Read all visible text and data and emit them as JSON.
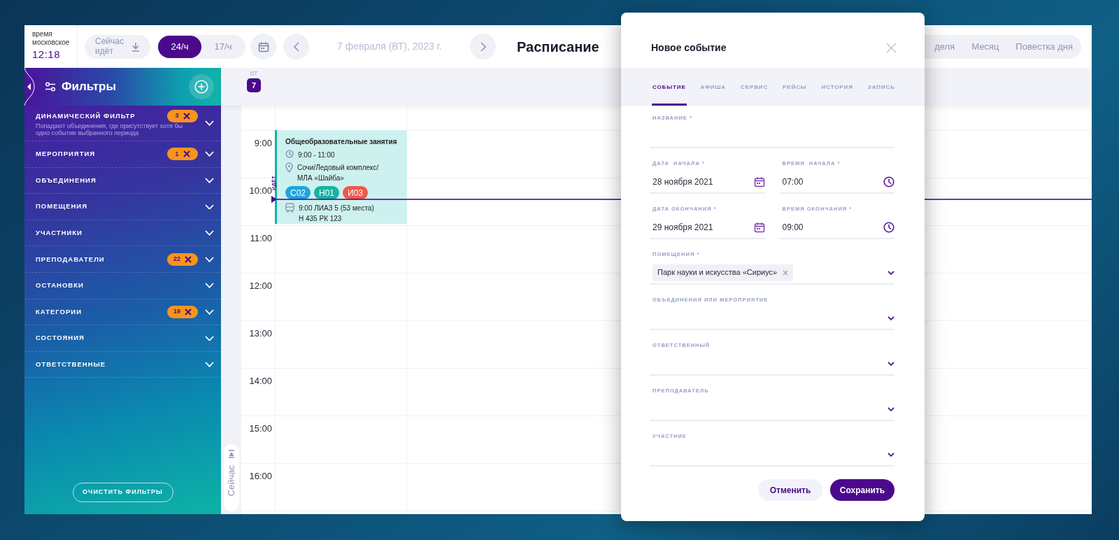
{
  "clock": {
    "label": "время московское",
    "time": "12:18"
  },
  "now_button": {
    "label": "Сейчас идёт"
  },
  "scale_toggle": [
    {
      "label": "24/ч",
      "selected": true
    },
    {
      "label": "17/ч",
      "selected": false
    }
  ],
  "date": "7 февраля (ВТ), 2023 г.",
  "title": "Расписание",
  "views": [
    {
      "label": "деля",
      "selected": false
    },
    {
      "label": "Месяц",
      "selected": false
    },
    {
      "label": "Повестка дня",
      "selected": false
    }
  ],
  "sidebar": {
    "title": "Фильтры",
    "filters": [
      {
        "label": "ДИНАМИЧЕСКИЙ ФИЛЬТР",
        "description": "Попадают объединения, где присутствует хотя бы одно событие выбранного периода",
        "count": "3"
      },
      {
        "label": "МЕРОПРИЯТИЯ",
        "count": "1"
      },
      {
        "label": "ОБЪЕДИНЕНИЯ"
      },
      {
        "label": "ПОМЕЩЕНИЯ"
      },
      {
        "label": "УЧАСТНИКИ"
      },
      {
        "label": "ПРЕПОДАВАТЕЛИ",
        "count": "22"
      },
      {
        "label": "ОСТАНОВКИ"
      },
      {
        "label": "КАТЕГОРИИ",
        "count": "19"
      },
      {
        "label": "СОСТОЯНИЯ"
      },
      {
        "label": "ОТВЕТСТВЕННЫЕ"
      }
    ],
    "clear_button": "ОЧИСТИТЬ ФИЛЬТРЫ"
  },
  "calendar": {
    "weekday": "ВТ",
    "day": "7",
    "now_button": "Сейчас",
    "now_label": "ИДЁТ",
    "hours": [
      "9:00",
      "10:00",
      "11:00",
      "12:00",
      "13:00",
      "14:00",
      "15:00",
      "16:00"
    ],
    "events": [
      {
        "title": "Общеобразовательные занятия",
        "time": "9:00 - 11:00",
        "place": "Сочи/Ледовый комплекс/ МЛА «Шайба»",
        "tags": [
          {
            "label": "С02",
            "color": "#1ea6dd"
          },
          {
            "label": "Н01",
            "color": "#16b2a2"
          },
          {
            "label": "И03",
            "color": "#f0584b"
          }
        ],
        "transport": [
          "9:00 ЛИАЗ 5 (53 места)",
          "Н 435 РК 123"
        ]
      }
    ]
  },
  "modal": {
    "title": "Новое событие",
    "tabs": [
      {
        "label": "СОБЫТИЕ",
        "selected": true
      },
      {
        "label": "АФИША",
        "selected": false
      },
      {
        "label": "СЕРВИС",
        "selected": false
      },
      {
        "label": "РЕЙСЫ",
        "selected": false
      },
      {
        "label": "ИСТОРИЯ",
        "selected": false
      },
      {
        "label": "ЗАПИСЬ",
        "selected": false
      }
    ],
    "fields": [
      {
        "kind": "text",
        "label": "НАЗВАНИЕ *"
      },
      {
        "kind": "date",
        "label": "ДАТА  НАЧАЛА *",
        "value": "28 ноября 2021"
      },
      {
        "kind": "time",
        "label": "ВРЕМЯ  НАЧАЛА *",
        "value": "07:00"
      },
      {
        "kind": "date",
        "label": "ДАТА ОКОНЧАНИЯ *",
        "value": "29 ноября 2021"
      },
      {
        "kind": "time",
        "label": "ВРЕМЯ ОКОНЧАНИЯ *",
        "value": "09:00"
      },
      {
        "kind": "tags",
        "label": "ПОМЕЩЕНИЯ *",
        "chips": [
          "Парк науки и искусства «Сириус»"
        ]
      },
      {
        "kind": "select",
        "label": "ОБЪЕДИНЕНИЯ ИЛИ МЕРОПРИЯТИЕ"
      },
      {
        "kind": "select",
        "label": "ОТВЕТСТВЕННЫЙ"
      },
      {
        "kind": "select",
        "label": "ПРЕПОДАВАТЕЛЬ"
      },
      {
        "kind": "select",
        "label": "УЧАСТНИК"
      }
    ],
    "buttons": [
      {
        "kind": "secondary",
        "label": "Отменить"
      },
      {
        "kind": "primary",
        "label": "Сохранить"
      }
    ]
  }
}
